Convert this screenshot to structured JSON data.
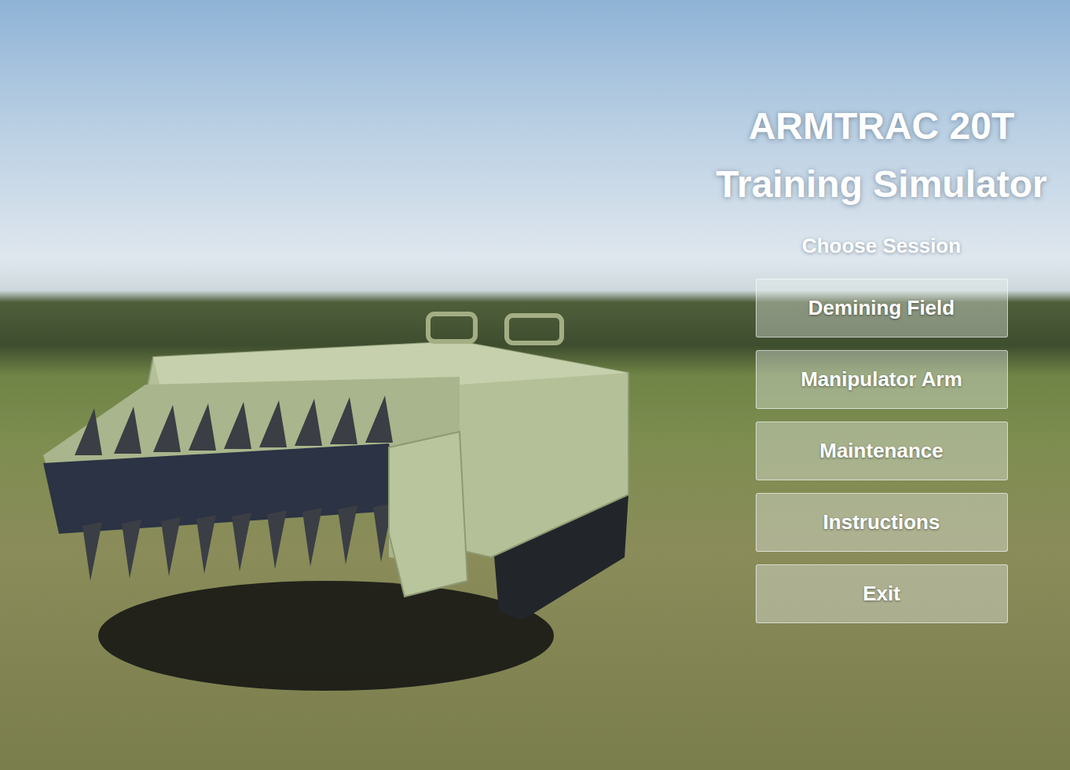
{
  "window": {
    "title_lines": [
      "ARMTRAC 20T",
      "Training Simulator"
    ]
  },
  "menu": {
    "heading": "Choose Session",
    "buttons": [
      {
        "label": "Demining Field"
      },
      {
        "label": "Manipulator Arm"
      },
      {
        "label": "Maintenance"
      },
      {
        "label": "Instructions"
      },
      {
        "label": "Exit"
      }
    ]
  }
}
